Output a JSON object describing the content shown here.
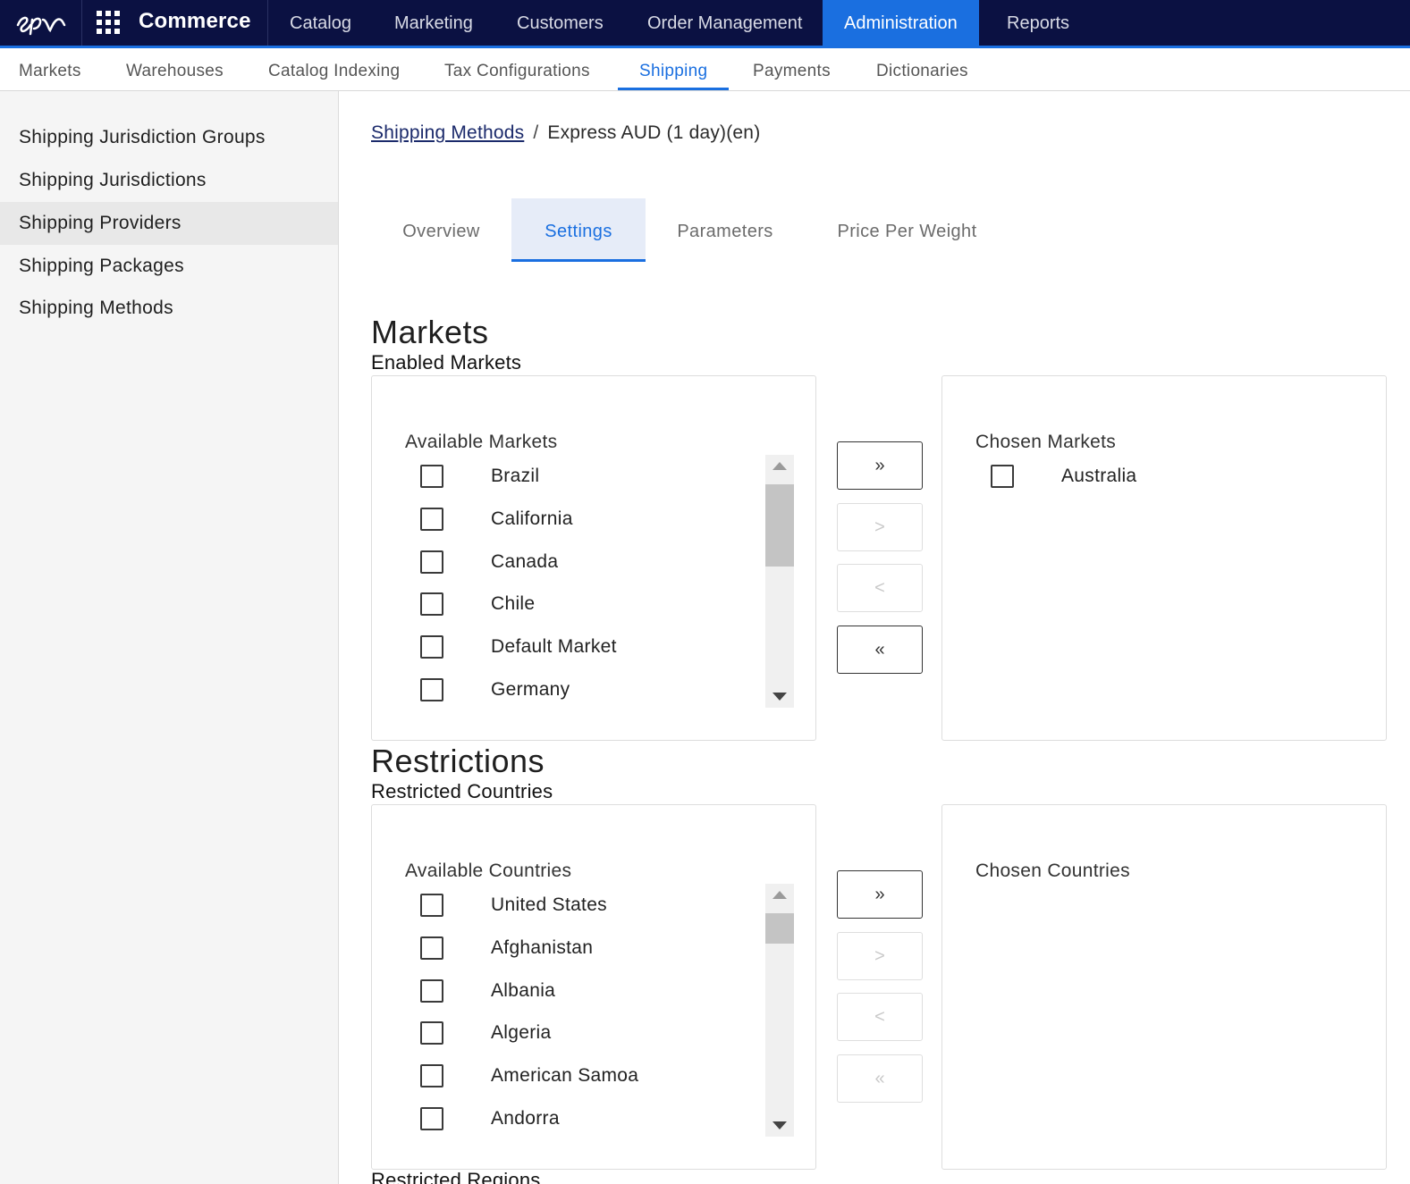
{
  "topbar": {
    "product": "Commerce",
    "nav": [
      "Catalog",
      "Marketing",
      "Customers",
      "Order Management",
      "Administration",
      "Reports"
    ],
    "active": "Administration",
    "accent": "#1a6fe0",
    "background": "#0b1142"
  },
  "subnav": {
    "items": [
      "Markets",
      "Warehouses",
      "Catalog Indexing",
      "Tax Configurations",
      "Shipping",
      "Payments",
      "Dictionaries"
    ],
    "active": "Shipping"
  },
  "sidebar": {
    "items": [
      "Shipping Jurisdiction Groups",
      "Shipping Jurisdictions",
      "Shipping Providers",
      "Shipping Packages",
      "Shipping Methods"
    ],
    "active": "Shipping Providers"
  },
  "breadcrumb": {
    "link": "Shipping Methods",
    "separator": "/",
    "current": "Express AUD (1 day)(en)"
  },
  "tabs": {
    "items": [
      "Overview",
      "Settings",
      "Parameters",
      "Price Per Weight"
    ],
    "active": "Settings"
  },
  "markets": {
    "title": "Markets",
    "subtitle": "Enabled Markets",
    "available_label": "Available Markets",
    "available": [
      "Brazil",
      "California",
      "Canada",
      "Chile",
      "Default Market",
      "Germany"
    ],
    "chosen_label": "Chosen Markets",
    "chosen": [
      "Australia"
    ],
    "buttons": {
      "add_all": "»",
      "add": ">",
      "remove": "<",
      "remove_all": "«"
    }
  },
  "restrictions": {
    "title": "Restrictions",
    "subtitle": "Restricted Countries",
    "available_label": "Available Countries",
    "available": [
      "United States",
      "Afghanistan",
      "Albania",
      "Algeria",
      "American Samoa",
      "Andorra"
    ],
    "chosen_label": "Chosen Countries",
    "chosen": [],
    "buttons": {
      "add_all": "»",
      "add": ">",
      "remove": "<",
      "remove_all": "«"
    }
  },
  "cut_off": "Restricted Regions"
}
